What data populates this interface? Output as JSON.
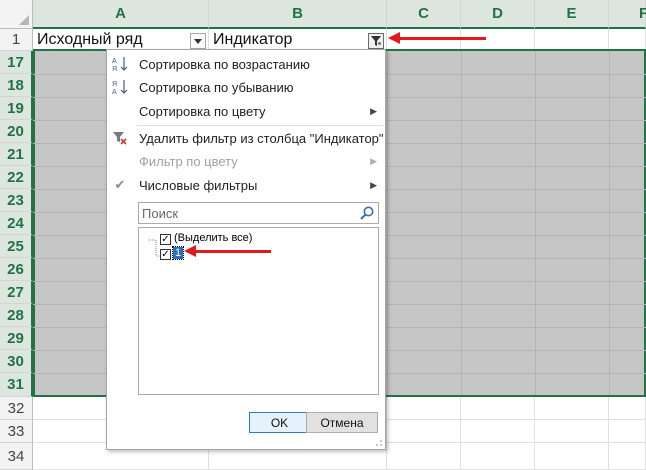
{
  "columns": [
    "A",
    "B",
    "C",
    "D",
    "E",
    "F"
  ],
  "rows_top": [
    "1"
  ],
  "rows_filtered": [
    "17",
    "18",
    "19",
    "20",
    "21",
    "22",
    "23",
    "24",
    "25",
    "26",
    "27",
    "28",
    "29",
    "30",
    "31"
  ],
  "rows_bottom": [
    "32",
    "33",
    "34"
  ],
  "header_cells": {
    "a1": "Исходный ряд",
    "b1": "Индикатор"
  },
  "menu": {
    "sort_asc": "Сортировка по возрастанию",
    "sort_desc": "Сортировка по убыванию",
    "sort_color": "Сортировка по цвету",
    "clear_filter": "Удалить фильтр из столбца \"Индикатор\"",
    "filter_color": "Фильтр по цвету",
    "number_filters": "Числовые фильтры",
    "search_placeholder": "Поиск",
    "select_all": "(Выделить все)",
    "item_1": "1",
    "ok": "OK",
    "cancel": "Отмена"
  },
  "icons": {
    "sort_asc": "sort-az-icon",
    "sort_desc": "sort-za-icon",
    "clear_filter": "clear-filter-icon",
    "number_filters": "checkmark-icon",
    "search": "magnifier-icon",
    "filter_button": "filter-funnel-icon",
    "dropdown": "dropdown-arrow-icon"
  },
  "colors": {
    "accent_green": "#217346",
    "annotation_red": "#e01b1b",
    "selection_gray": "#c6c6c6"
  }
}
